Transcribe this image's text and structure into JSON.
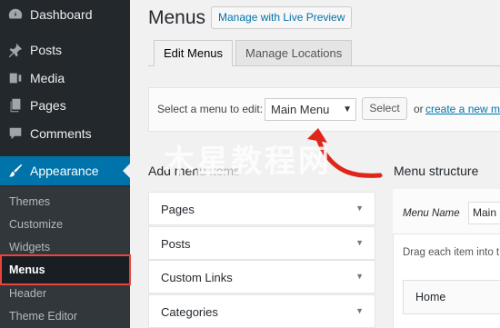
{
  "sidebar": {
    "items": [
      {
        "label": "Dashboard",
        "icon": "dashboard-icon"
      },
      {
        "label": "Posts",
        "icon": "pin-icon"
      },
      {
        "label": "Media",
        "icon": "media-icon"
      },
      {
        "label": "Pages",
        "icon": "pages-icon"
      },
      {
        "label": "Comments",
        "icon": "comment-icon"
      },
      {
        "label": "Appearance",
        "icon": "paintbrush-icon"
      }
    ],
    "submenu": [
      "Themes",
      "Customize",
      "Widgets",
      "Menus",
      "Header",
      "Theme Editor"
    ],
    "active_submenu": "Menus"
  },
  "header": {
    "title": "Menus",
    "live_preview_label": "Manage with Live Preview"
  },
  "tabs": [
    {
      "label": "Edit Menus",
      "active": true
    },
    {
      "label": "Manage Locations",
      "active": false
    }
  ],
  "menu_select": {
    "label": "Select a menu to edit:",
    "selected": "Main Menu",
    "button_label": "Select",
    "or_text": "or",
    "create_link": "create a new me"
  },
  "add_items": {
    "title": "Add menu items",
    "sections": [
      "Pages",
      "Posts",
      "Custom Links",
      "Categories"
    ]
  },
  "structure": {
    "title": "Menu structure",
    "menu_name_label": "Menu Name",
    "menu_name_value": "Main",
    "drag_text": "Drag each item into t",
    "items": [
      "Home"
    ]
  },
  "watermark": "木星教程网",
  "colors": {
    "sidebar_bg": "#23282d",
    "active_bg": "#0073aa",
    "highlight_border": "#e8453c",
    "arrow": "#e0251b"
  }
}
